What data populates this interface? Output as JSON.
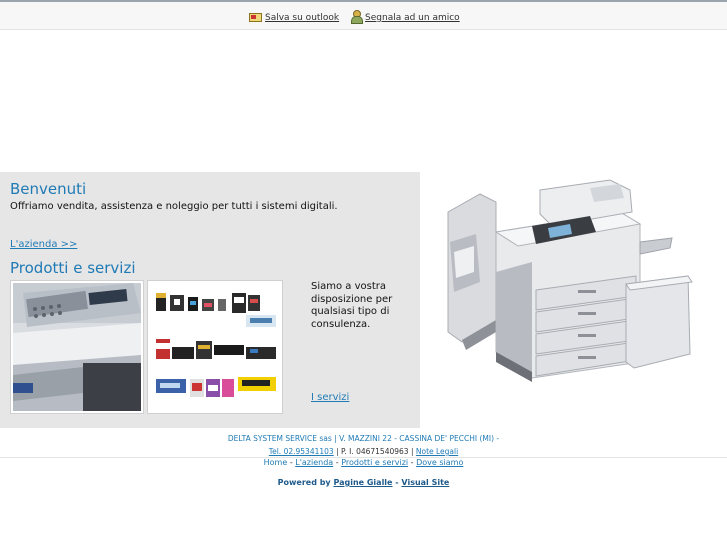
{
  "topbar": {
    "save_outlook": "Salva su outlook",
    "report_friend": "Segnala ad un amico"
  },
  "welcome": {
    "title": "Benvenuti",
    "intro": "Offriamo vendita, assistenza e noleggio per tutti i sistemi digitali.",
    "company_link": "L'azienda >>"
  },
  "products": {
    "title": "Prodotti e servizi",
    "description": "Siamo a vostra disposizione per qualsiasi tipo di consulenza.",
    "services_link": "I servizi"
  },
  "footer": {
    "address": "DELTA SYSTEM SERVICE sas | V. MAZZINI 22 - CASSINA DE' PECCHI (MI) -",
    "phone": "Tel. 02.95341103",
    "vat": "| P. I. 04671540963 |",
    "legal": "Note Legali",
    "nav": {
      "home": "Home",
      "sep": "-",
      "azienda": "L'azienda",
      "prodotti": "Prodotti e servizi",
      "dove": "Dove siamo"
    },
    "powered_by": "Powered by",
    "pagine_gialle": "Pagine Gialle",
    "dash": "-",
    "visual_site": "Visual Site"
  },
  "icons": [
    "outlook-icon",
    "friend-icon"
  ],
  "colors": {
    "accent": "#1f7ab5",
    "panel_bg": "#e6e6e6"
  }
}
